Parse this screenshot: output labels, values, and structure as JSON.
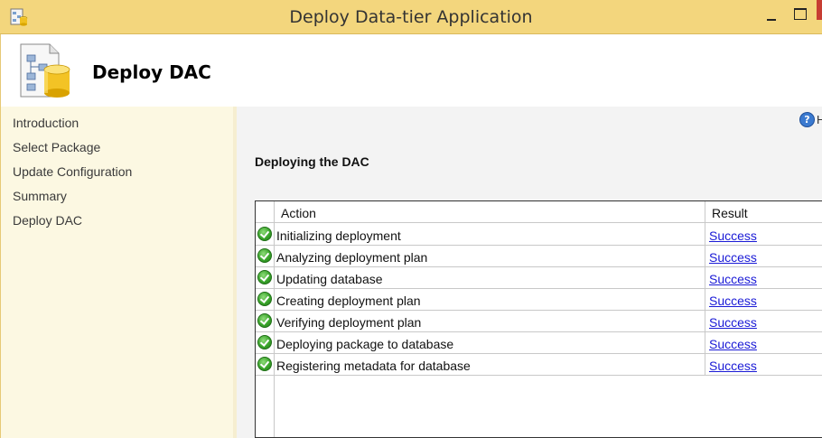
{
  "window": {
    "title": "Deploy Data-tier Application"
  },
  "header": {
    "title": "Deploy DAC"
  },
  "sidebar": {
    "items": [
      {
        "label": "Introduction"
      },
      {
        "label": "Select Package"
      },
      {
        "label": "Update Configuration"
      },
      {
        "label": "Summary"
      },
      {
        "label": "Deploy DAC"
      }
    ]
  },
  "content": {
    "help_label": "H",
    "section_title": "Deploying the DAC",
    "columns": {
      "action": "Action",
      "result": "Result"
    },
    "rows": [
      {
        "action": "Initializing deployment",
        "result": "Success"
      },
      {
        "action": "Analyzing deployment plan",
        "result": "Success"
      },
      {
        "action": "Updating database",
        "result": "Success"
      },
      {
        "action": "Creating deployment plan",
        "result": "Success"
      },
      {
        "action": "Verifying deployment plan",
        "result": "Success"
      },
      {
        "action": "Deploying package to database",
        "result": "Success"
      },
      {
        "action": "Registering metadata for database",
        "result": "Success"
      }
    ]
  },
  "icons": {
    "app": "dac-app-icon",
    "header": "database-package-icon",
    "help": "help-icon",
    "row_status": "success-check-icon"
  },
  "colors": {
    "titlebar": "#f3d67d",
    "sidebar": "#fcf8e2",
    "link": "#1a1ad6",
    "success": "#3aa52b"
  }
}
